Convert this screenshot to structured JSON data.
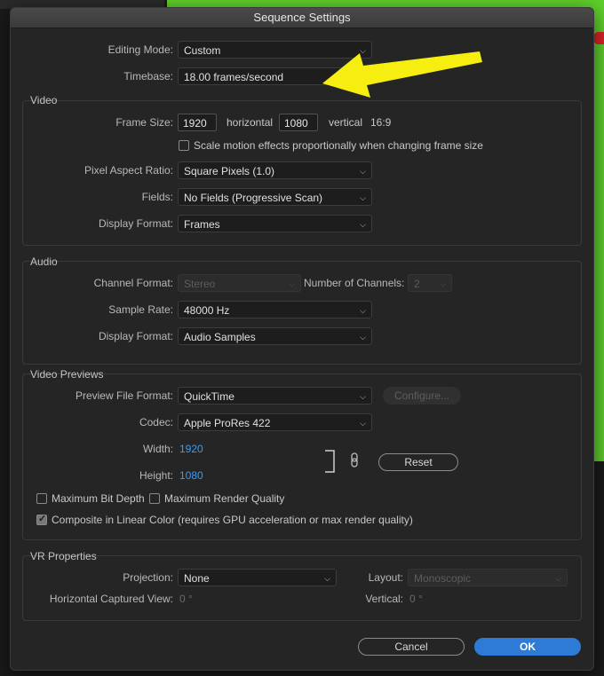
{
  "window": {
    "title": "Sequence Settings"
  },
  "general": {
    "editing_mode_label": "Editing Mode:",
    "editing_mode_value": "Custom",
    "timebase_label": "Timebase:",
    "timebase_value": "18.00  frames/second"
  },
  "video": {
    "title": "Video",
    "frame_size_label": "Frame Size:",
    "width": "1920",
    "horizontal_label": "horizontal",
    "height": "1080",
    "vertical_label": "vertical",
    "aspect": "16:9",
    "scale_motion_label": "Scale motion effects proportionally when changing frame size",
    "scale_motion_checked": false,
    "pixel_aspect_label": "Pixel Aspect Ratio:",
    "pixel_aspect_value": "Square Pixels (1.0)",
    "fields_label": "Fields:",
    "fields_value": "No Fields (Progressive Scan)",
    "display_format_label": "Display Format:",
    "display_format_value": "Frames"
  },
  "audio": {
    "title": "Audio",
    "channel_format_label": "Channel Format:",
    "channel_format_value": "Stereo",
    "num_channels_label": "Number of Channels:",
    "num_channels_value": "2",
    "sample_rate_label": "Sample Rate:",
    "sample_rate_value": "48000 Hz",
    "display_format_label": "Display Format:",
    "display_format_value": "Audio Samples"
  },
  "previews": {
    "title": "Video Previews",
    "file_format_label": "Preview File Format:",
    "file_format_value": "QuickTime",
    "configure_label": "Configure...",
    "codec_label": "Codec:",
    "codec_value": "Apple ProRes 422",
    "width_label": "Width:",
    "width_value": "1920",
    "height_label": "Height:",
    "height_value": "1080",
    "reset_label": "Reset",
    "max_bit_depth_label": "Maximum Bit Depth",
    "max_bit_depth_checked": false,
    "max_render_label": "Maximum Render Quality",
    "max_render_checked": false,
    "linear_color_label": "Composite in Linear Color (requires GPU acceleration or max render quality)",
    "linear_color_checked": true
  },
  "vr": {
    "title": "VR Properties",
    "projection_label": "Projection:",
    "projection_value": "None",
    "layout_label": "Layout:",
    "layout_value": "Monoscopic",
    "hcv_label": "Horizontal Captured View:",
    "hcv_value": "0 °",
    "vertical_label": "Vertical:",
    "vertical_value": "0 °"
  },
  "buttons": {
    "cancel": "Cancel",
    "ok": "OK"
  },
  "colors": {
    "accent": "#2d7bd6",
    "link_value": "#3e9bf0",
    "arrow": "#f5ee10"
  }
}
